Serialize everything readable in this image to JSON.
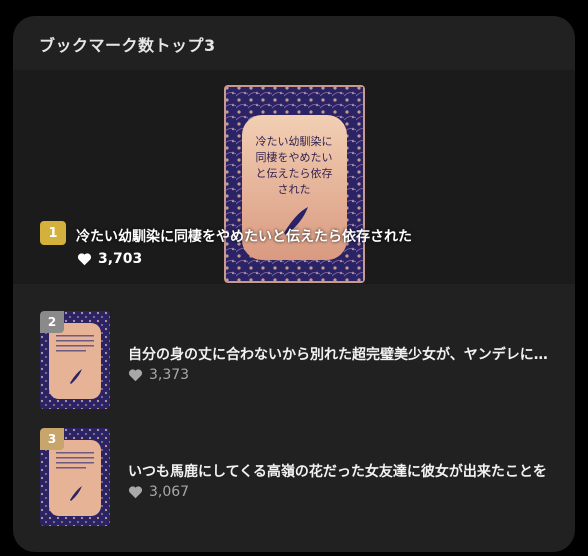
{
  "panel": {
    "title": "ブックマーク数トップ3"
  },
  "ranking": [
    {
      "rank": "1",
      "title": "冷たい幼馴染に同棲をやめたいと伝えたら依存された",
      "cover_text": [
        "冷たい幼馴染に",
        "同棲をやめたい",
        "と伝えたら依存",
        "された"
      ],
      "likes": "3,703"
    },
    {
      "rank": "2",
      "title": "自分の身の丈に合わないから別れた超完璧美少女が、ヤンデレに…",
      "likes": "3,373"
    },
    {
      "rank": "3",
      "title": "いつも馬鹿にしてくる高嶺の花だった女友達に彼女が出来たことを…",
      "likes": "3,067"
    }
  ],
  "colors": {
    "gold": "#d4b13c",
    "silver": "#8a8a8a",
    "bronze": "#c8a56a",
    "cover_navy": "#2a2466",
    "cover_peach": "#e7b59a"
  },
  "icons": {
    "likes": "heart-icon",
    "cover_ornament": "feather-icon"
  }
}
